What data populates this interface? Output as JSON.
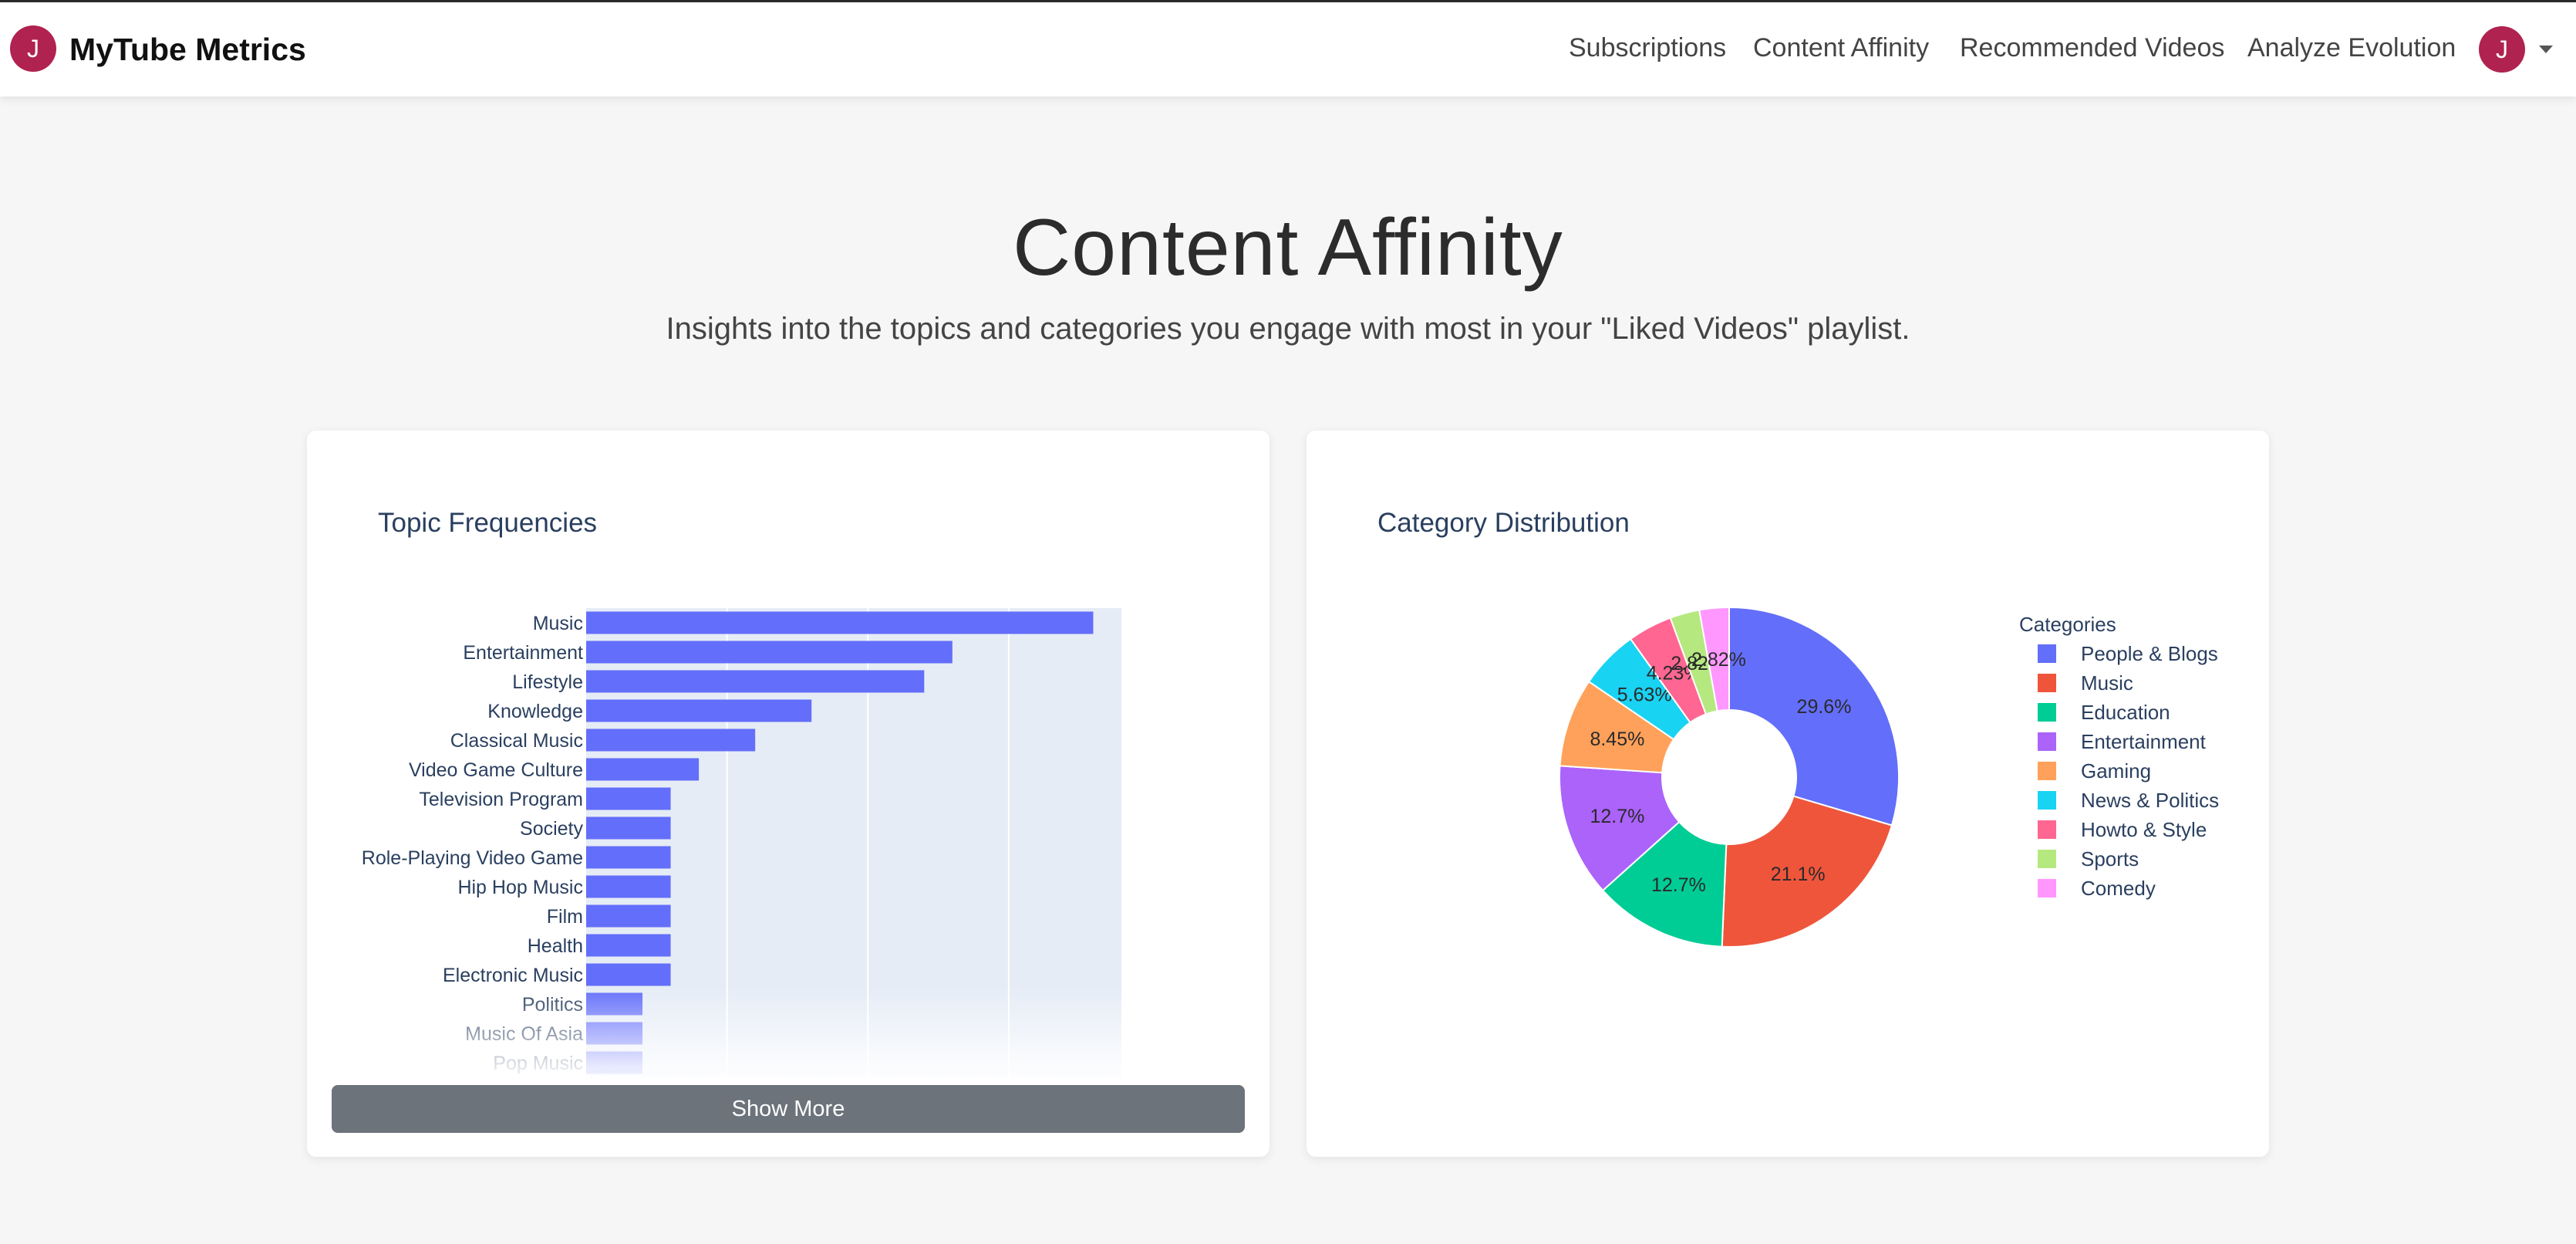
{
  "brand": {
    "avatar_letter": "J",
    "name": "MyTube Metrics"
  },
  "nav": {
    "links": [
      "Subscriptions",
      "Content Affinity",
      "Recommended Videos",
      "Analyze Evolution"
    ],
    "user_avatar_letter": "J"
  },
  "page": {
    "title": "Content Affinity",
    "subtitle": "Insights into the topics and categories you engage with most in your \"Liked Videos\" playlist."
  },
  "topic_card": {
    "title": "Topic Frequencies",
    "show_more_label": "Show More"
  },
  "category_card": {
    "title": "Category Distribution",
    "legend_title": "Categories"
  },
  "colors": {
    "bar": "#636efa",
    "plot_bg": "#e5ecf6",
    "avatar": "#b0224f",
    "button": "#6d737b"
  },
  "chart_data": [
    {
      "type": "bar",
      "orientation": "horizontal",
      "title": "Topic Frequencies",
      "categories": [
        "Music",
        "Entertainment",
        "Lifestyle",
        "Knowledge",
        "Classical Music",
        "Video Game Culture",
        "Television Program",
        "Society",
        "Role-Playing Video Game",
        "Hip Hop Music",
        "Film",
        "Health",
        "Electronic Music",
        "Politics",
        "Music Of Asia",
        "Pop Music"
      ],
      "values": [
        18,
        13,
        12,
        8,
        6,
        4,
        3,
        3,
        3,
        3,
        3,
        3,
        3,
        2,
        2,
        2
      ],
      "xlim": [
        0,
        19
      ],
      "grid": true
    },
    {
      "type": "pie",
      "hole": true,
      "title": "Category Distribution",
      "legend_title": "Categories",
      "legend_position": "right",
      "categories": [
        "People & Blogs",
        "Music",
        "Education",
        "Entertainment",
        "Gaming",
        "News & Politics",
        "Howto & Style",
        "Sports",
        "Comedy"
      ],
      "values": [
        29.6,
        21.1,
        12.7,
        12.7,
        8.45,
        5.63,
        4.23,
        2.82,
        2.82
      ],
      "labels": [
        "29.6%",
        "21.1%",
        "12.7%",
        "12.7%",
        "8.45%",
        "5.63%",
        "4.23%",
        "2.82%",
        "2.82%"
      ],
      "colors": [
        "#636efa",
        "#ef553b",
        "#00cc96",
        "#ab63fa",
        "#ffa15a",
        "#19d3f3",
        "#ff6692",
        "#b6e880",
        "#ff97ff"
      ]
    }
  ]
}
